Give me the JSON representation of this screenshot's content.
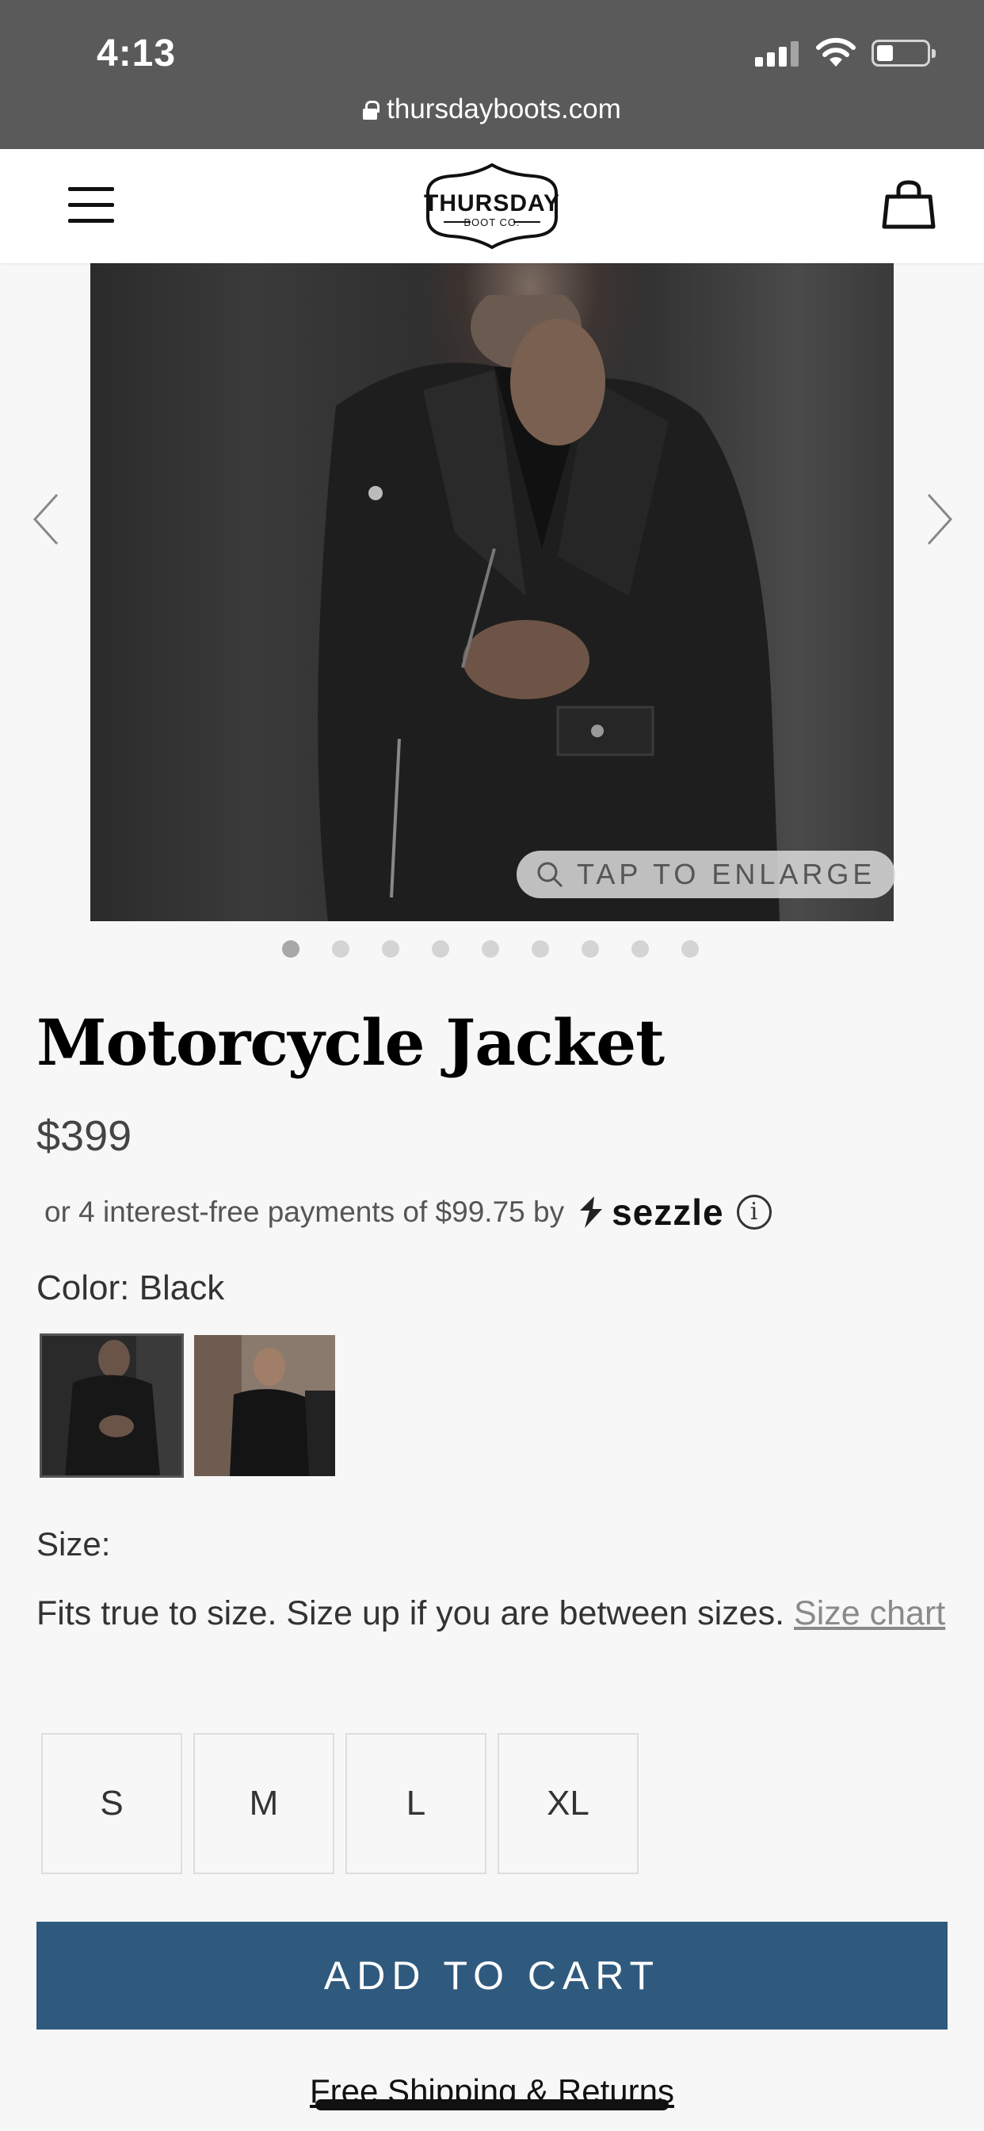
{
  "status_bar": {
    "time": "4:13"
  },
  "browser": {
    "url": "thursdayboots.com"
  },
  "header": {
    "logo_text": "THURSDAY",
    "logo_subtext": "BOOT CO."
  },
  "gallery": {
    "enlarge_label": "TAP TO ENLARGE",
    "dot_count": 9,
    "active_dot": 1
  },
  "product": {
    "title": "Motorcycle Jacket",
    "price": "$399",
    "installment_text": "or 4 interest-free payments of $99.75 by",
    "installment_provider": "sezzle",
    "color_label": "Color: Black",
    "size_label": "Size:",
    "fit_text": "Fits true to size. Size up if you are between sizes.",
    "size_chart_link": "Size chart",
    "sizes": [
      "S",
      "M",
      "L",
      "XL"
    ],
    "add_to_cart": "ADD TO CART",
    "shipping_text": "Free Shipping & Returns"
  },
  "colors": {
    "accent": "#2f5a7e",
    "status_bar": "#5a5a5a",
    "background": "#f7f7f7"
  }
}
